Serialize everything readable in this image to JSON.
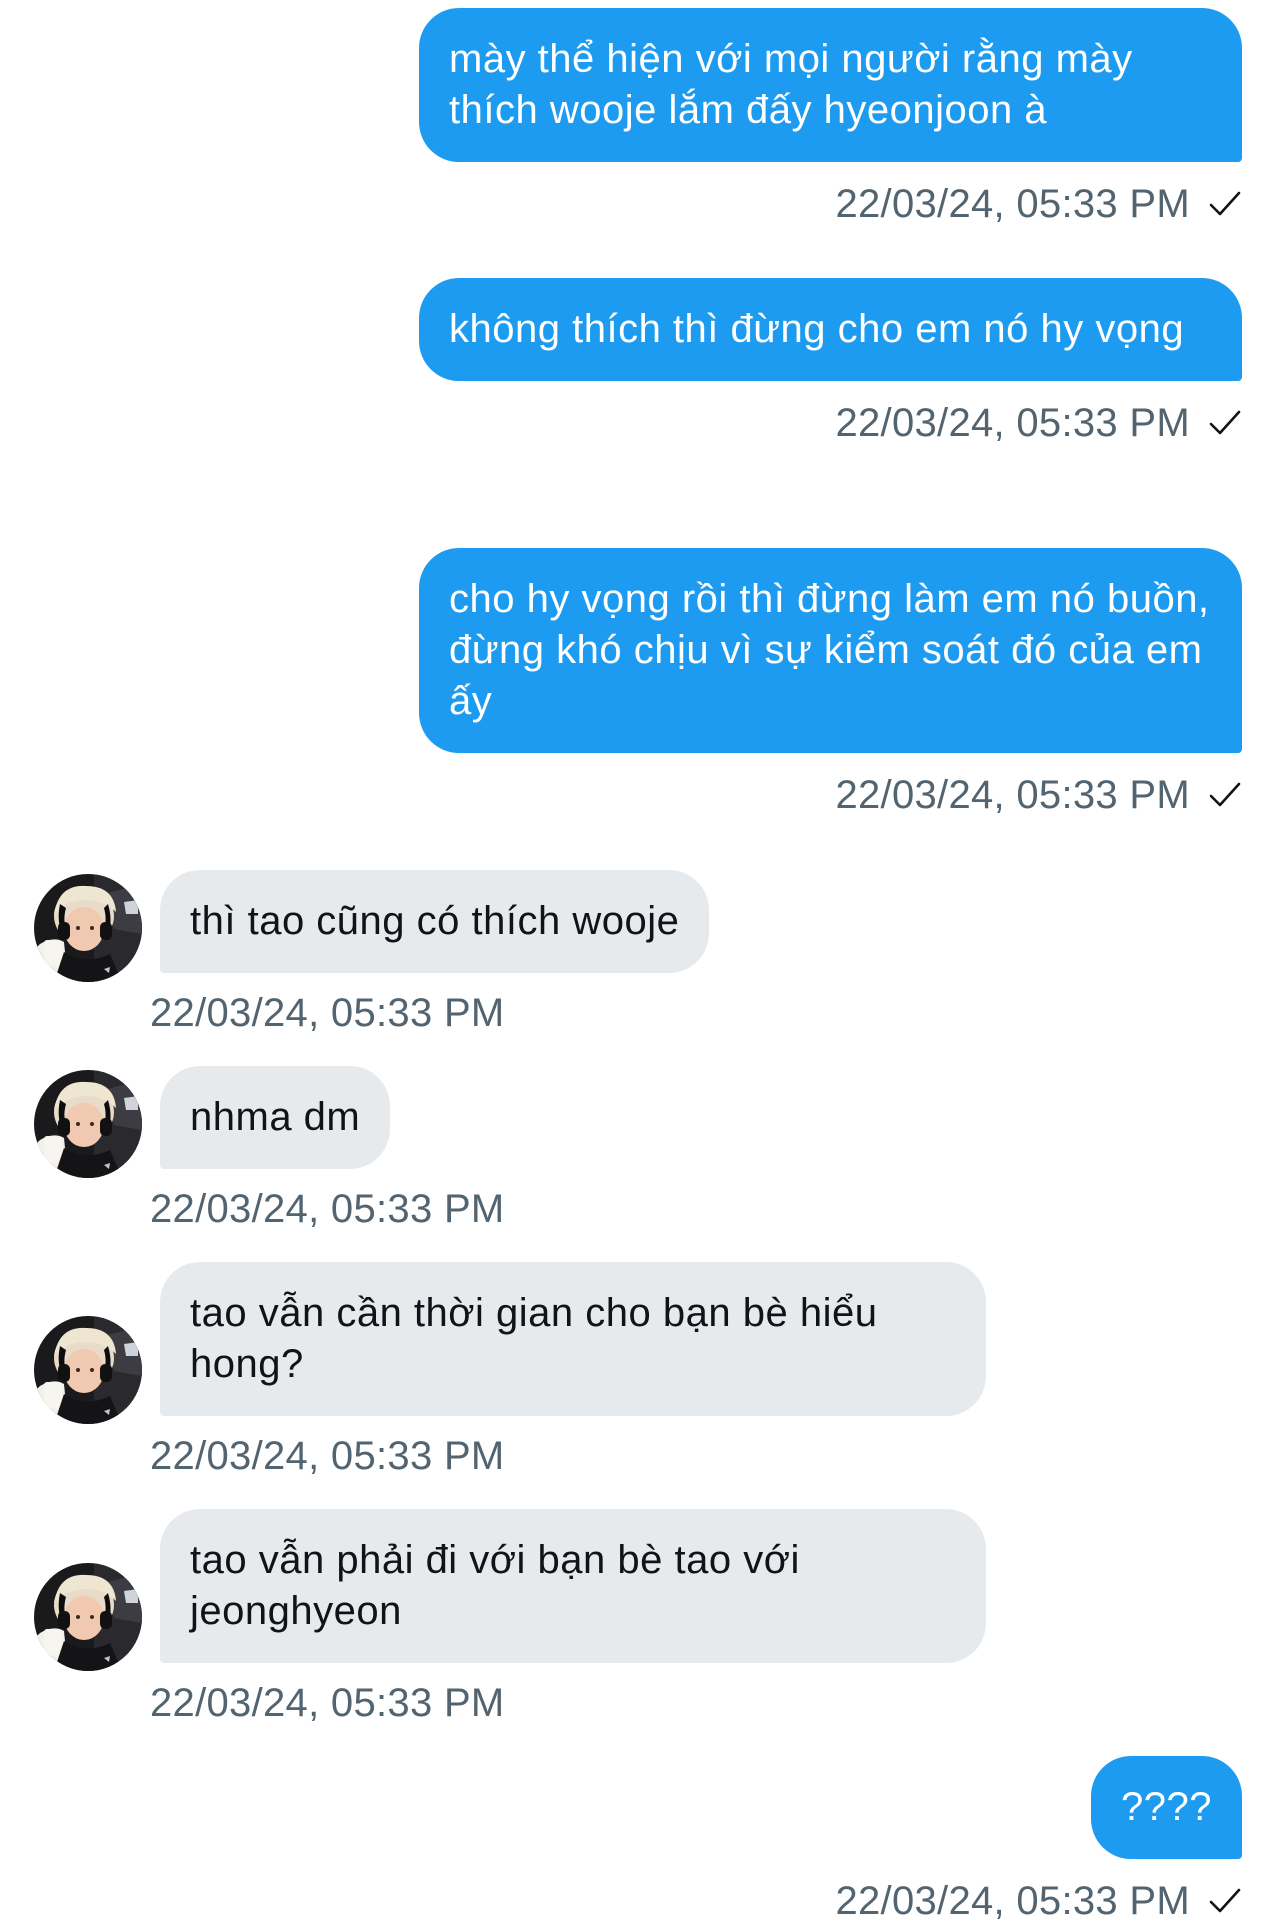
{
  "colors": {
    "outgoing_bubble": "#1d9bf0",
    "incoming_bubble": "#e7eaed",
    "timestamp": "#536471"
  },
  "messages": [
    {
      "direction": "outgoing",
      "text": "mày thể hiện với mọi người rằng mày thích wooje lắm đấy hyeonjoon à",
      "timestamp": "22/03/24, 05:33 PM",
      "status_icon": "check-icon"
    },
    {
      "direction": "outgoing",
      "text": "không thích thì đừng cho em nó hy vọng",
      "timestamp": "22/03/24, 05:33 PM",
      "status_icon": "check-icon"
    },
    {
      "direction": "outgoing",
      "text": "cho hy vọng rồi thì đừng làm em nó buồn, đừng khó chịu vì sự kiểm soát đó của em ấy",
      "timestamp": "22/03/24, 05:33 PM",
      "status_icon": "check-icon"
    },
    {
      "direction": "incoming",
      "text": "thì tao cũng có thích wooje",
      "timestamp": "22/03/24, 05:33 PM",
      "avatar": "avatar-photo"
    },
    {
      "direction": "incoming",
      "text": "nhma dm",
      "timestamp": "22/03/24, 05:33 PM",
      "avatar": "avatar-photo"
    },
    {
      "direction": "incoming",
      "text": "tao vẫn cần thời gian cho bạn bè hiểu hong?",
      "timestamp": "22/03/24, 05:33 PM",
      "avatar": "avatar-photo"
    },
    {
      "direction": "incoming",
      "text": "tao vẫn phải đi với bạn bè tao với jeonghyeon",
      "timestamp": "22/03/24, 05:33 PM",
      "avatar": "avatar-photo"
    },
    {
      "direction": "outgoing",
      "text": "????",
      "timestamp": "22/03/24, 05:33 PM",
      "status_icon": "check-icon"
    }
  ]
}
